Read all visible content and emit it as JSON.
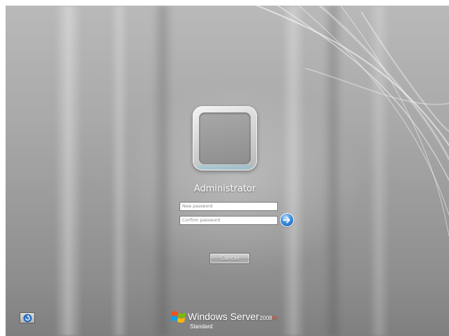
{
  "login": {
    "username": "Administrator",
    "new_password": {
      "placeholder": "New password",
      "value": ""
    },
    "confirm_password": {
      "placeholder": "Confirm password",
      "value": ""
    },
    "cancel_label": "Cancel"
  },
  "icons": {
    "submit": "arrow-right-icon",
    "ease_of_access": "ease-of-access-icon",
    "logo": "windows-flag-icon"
  },
  "branding": {
    "product": "Windows Server",
    "version": "2008",
    "release": "R2",
    "edition": "Standard"
  },
  "colors": {
    "background": "#a3a3a3",
    "accent_blue": "#2f78cf",
    "release_orange": "#e2582f"
  }
}
